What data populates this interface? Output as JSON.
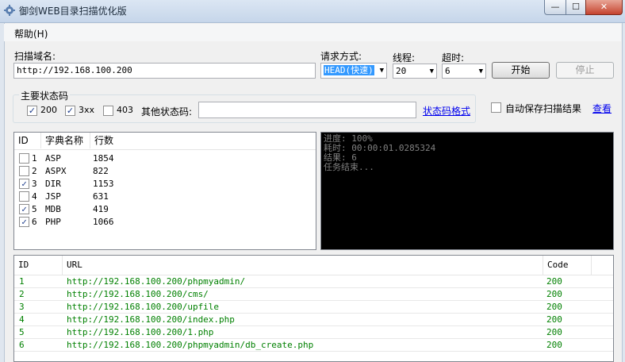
{
  "window": {
    "title": "御剑WEB目录扫描优化版",
    "min": "—",
    "max": "☐",
    "close": "✕"
  },
  "menu": {
    "help": "帮助(H)"
  },
  "scan": {
    "domain_label": "扫描域名:",
    "domain_value": "http://192.168.100.200",
    "method_label": "请求方式:",
    "method_value": "HEAD(快速)",
    "threads_label": "线程:",
    "threads_value": "20",
    "timeout_label": "超时:",
    "timeout_value": "6",
    "start_label": "开始",
    "stop_label": "停止"
  },
  "status": {
    "group_label": "主要状态码",
    "c200": "200",
    "c3xx": "3xx",
    "c403": "403",
    "other_label": "其他状态码:",
    "other_value": "",
    "format_link": "状态码格式",
    "autosave_label": "自动保存扫描结果",
    "view_link": "查看"
  },
  "dict": {
    "headers": [
      "ID",
      "字典名称",
      "行数"
    ],
    "rows": [
      {
        "checked": false,
        "id": "1",
        "name": "ASP",
        "count": "1854"
      },
      {
        "checked": false,
        "id": "2",
        "name": "ASPX",
        "count": "822"
      },
      {
        "checked": true,
        "id": "3",
        "name": "DIR",
        "count": "1153"
      },
      {
        "checked": false,
        "id": "4",
        "name": "JSP",
        "count": "631"
      },
      {
        "checked": true,
        "id": "5",
        "name": "MDB",
        "count": "419"
      },
      {
        "checked": true,
        "id": "6",
        "name": "PHP",
        "count": "1066"
      }
    ]
  },
  "console": {
    "lines": [
      "进度: 100%",
      "耗时: 00:00:01.0285324",
      "结果: 6",
      "任务结束..."
    ]
  },
  "results": {
    "headers": [
      "ID",
      "URL",
      "Code"
    ],
    "rows": [
      {
        "id": "1",
        "url": "http://192.168.100.200/phpmyadmin/",
        "code": "200"
      },
      {
        "id": "2",
        "url": "http://192.168.100.200/cms/",
        "code": "200"
      },
      {
        "id": "3",
        "url": "http://192.168.100.200/upfile",
        "code": "200"
      },
      {
        "id": "4",
        "url": "http://192.168.100.200/index.php",
        "code": "200"
      },
      {
        "id": "5",
        "url": "http://192.168.100.200/1.php",
        "code": "200"
      },
      {
        "id": "6",
        "url": "http://192.168.100.200/phpmyadmin/db_create.php",
        "code": "200"
      }
    ]
  },
  "colors": {
    "result_text": "#008000",
    "console_bg": "#000000",
    "console_text": "#808080"
  }
}
